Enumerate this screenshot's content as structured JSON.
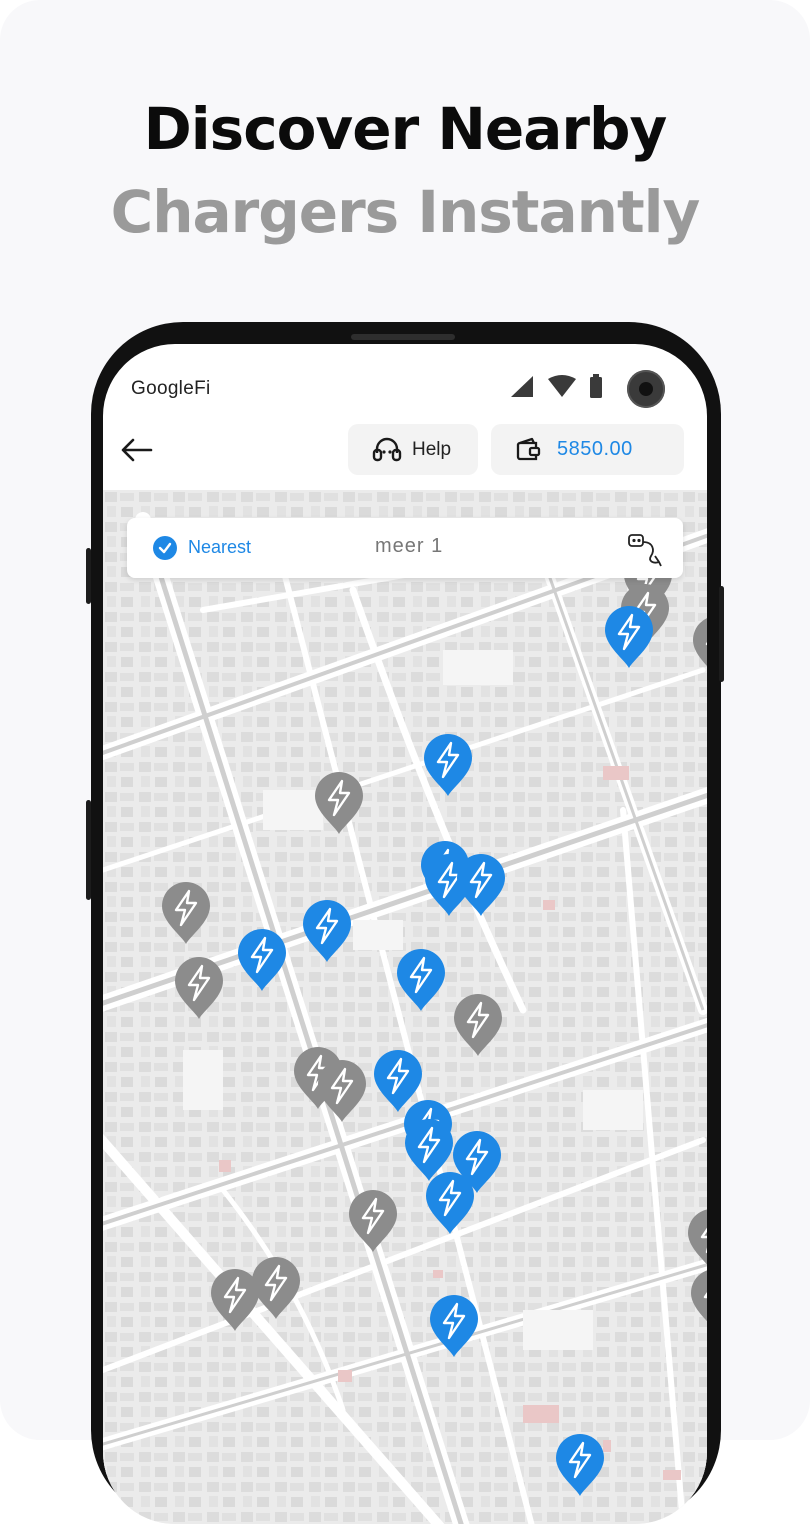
{
  "headline": {
    "line1": "Discover Nearby",
    "line2": "Chargers Instantly"
  },
  "status_bar": {
    "carrier": "GoogleFi",
    "icons": [
      "signal-icon",
      "wifi-icon",
      "battery-icon"
    ]
  },
  "header": {
    "back_icon": "arrow-left-icon",
    "help": {
      "icon": "headset-icon",
      "label": "Help"
    },
    "wallet": {
      "icon": "wallet-icon",
      "balance": "5850.00"
    }
  },
  "filter": {
    "nearest_label": "Nearest",
    "nearest_checked": true,
    "selected": "meer 1",
    "icon": "ev-plug-icon"
  },
  "map": {
    "pin_icon": "lightning-pin-icon",
    "colors": {
      "available": "#1e88e5",
      "unavailable": "#8c8c8c"
    }
  },
  "colors": {
    "accent": "#1e88e5",
    "headline_dark": "#0b0b0b",
    "headline_gray": "#9a9a9a"
  }
}
